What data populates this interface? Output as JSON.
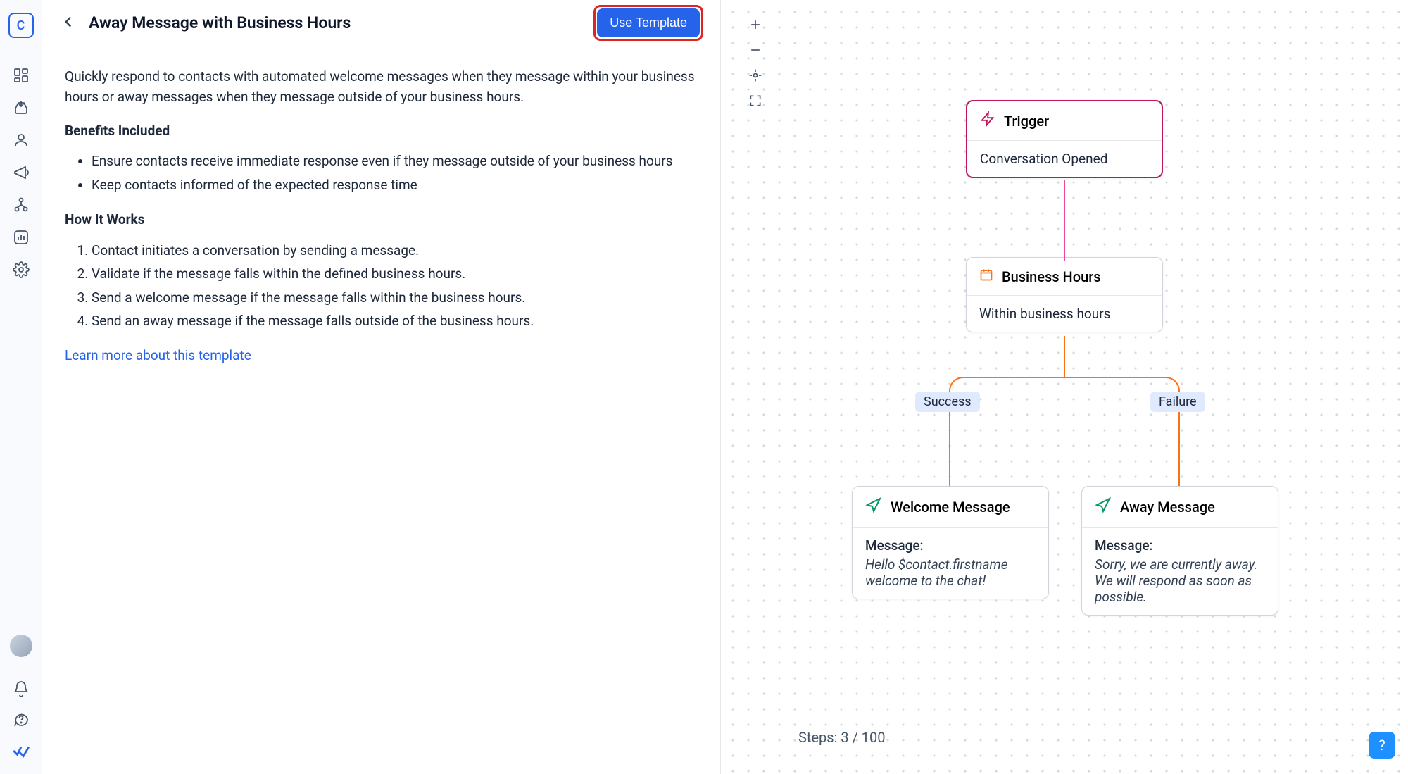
{
  "sidebar": {
    "logo": "C"
  },
  "header": {
    "title": "Away Message with Business Hours",
    "use_template": "Use Template"
  },
  "detail": {
    "intro": "Quickly respond to contacts with automated welcome messages when they message within your business hours or away messages when they message outside of your business hours.",
    "benefits_heading": "Benefits Included",
    "benefits": [
      "Ensure contacts receive immediate response even if they message outside of your business hours",
      "Keep contacts informed of the expected response time"
    ],
    "how_heading": "How It Works",
    "steps": [
      "Contact initiates a conversation by sending a message.",
      "Validate if the message falls within the defined business hours.",
      "Send a welcome message if the message falls within the business hours.",
      "Send an away message if the message falls outside of the business hours."
    ],
    "learn_more": "Learn more about this template"
  },
  "canvas": {
    "steps_label": "Steps: 3 / 100"
  },
  "flow": {
    "trigger": {
      "title": "Trigger",
      "body": "Conversation Opened"
    },
    "business": {
      "title": "Business Hours",
      "body": "Within business hours"
    },
    "branch_success": "Success",
    "branch_failure": "Failure",
    "welcome": {
      "title": "Welcome Message",
      "msg_label": "Message:",
      "msg_text": "Hello $contact.firstname welcome to the chat!"
    },
    "away": {
      "title": "Away Message",
      "msg_label": "Message:",
      "msg_text": "Sorry, we are currently away. We will respond as soon as possible."
    }
  },
  "help": {
    "label": "?"
  }
}
